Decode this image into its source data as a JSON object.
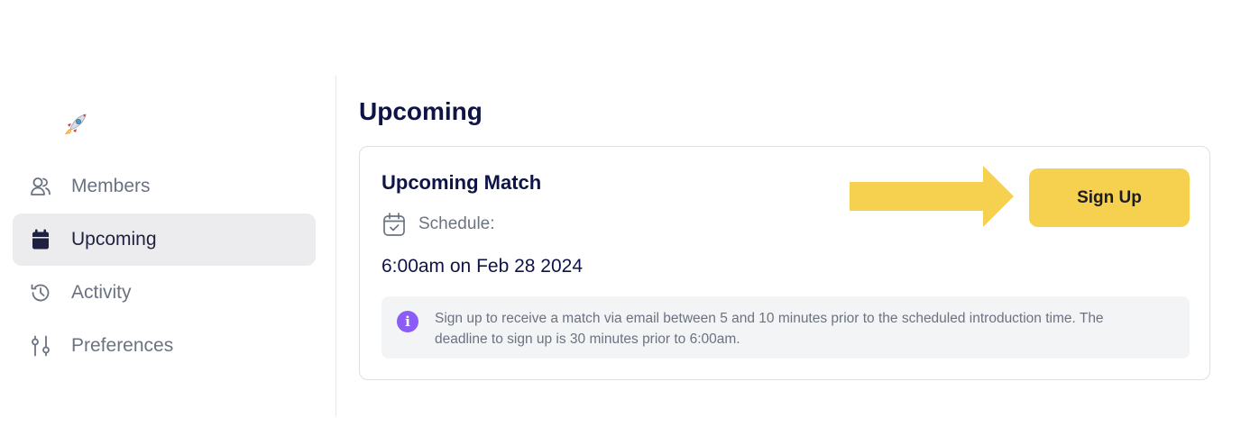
{
  "sidebar": {
    "logo_icon": "rocket-icon",
    "items": [
      {
        "label": "Members",
        "icon": "users-icon",
        "active": false
      },
      {
        "label": "Upcoming",
        "icon": "calendar-icon",
        "active": true
      },
      {
        "label": "Activity",
        "icon": "history-icon",
        "active": false
      },
      {
        "label": "Preferences",
        "icon": "sliders-icon",
        "active": false
      }
    ]
  },
  "main": {
    "title": "Upcoming",
    "card": {
      "title": "Upcoming Match",
      "schedule_label": "Schedule:",
      "schedule_value": "6:00am on Feb 28 2024",
      "signup_label": "Sign Up",
      "info_text": "Sign up to receive a match via email between 5 and 10 minutes prior to the scheduled introduction time. The deadline to sign up is 30 minutes prior to 6:00am."
    }
  },
  "colors": {
    "accent": "#f6d150",
    "navy": "#0f1446",
    "info": "#8b5cf6",
    "active_bg": "#ececee",
    "muted": "#6b7280"
  }
}
